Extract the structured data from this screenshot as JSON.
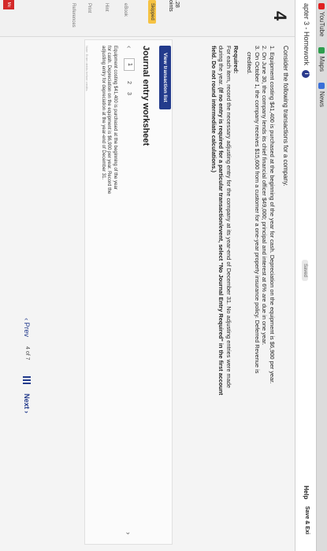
{
  "bookmarks": [
    {
      "label": "YouTube",
      "color": "#e02020"
    },
    {
      "label": "Maps",
      "color": "#2e9e4e"
    },
    {
      "label": "News",
      "color": "#3a6fd8"
    }
  ],
  "header": {
    "chapter": "apter 3 - Homework",
    "status": "Saved",
    "help": "Help",
    "save_exit": "Save & Exi"
  },
  "rail": {
    "question_number": "4",
    "points": ".28\noints",
    "skipped": "Skipped",
    "links": [
      "eBook",
      "Hint",
      "Print",
      "References"
    ]
  },
  "question": {
    "intro": "Consider the following transactions for a company.",
    "items": [
      "1. Equipment costing $41,400 is purchased at the beginning of the year for cash. Depreciation on the equipment is $6,900 per year.",
      "2. On June 30, the company lends its chief financial officer $49,000; principal and interest at 6% are due in one year.",
      "3. On October 1, the company receives $15,600 from a customer for a one-year property insurance policy. Deferred Revenue is",
      "    credited."
    ],
    "required_title": "Required:",
    "required_line1": "For each item, record the necessary adjusting entry for the company at its year-end of December 31. No adjusting entries were made",
    "required_line2_plain": "during the year. ",
    "required_line2_bold": "(If no entry is required for a particular transaction/event, select \"No Journal Entry Required\" in the first account",
    "required_line3_bold": "field. Do not round intermediate calculations.)"
  },
  "worksheet": {
    "view_button": "View transaction list",
    "title": "Journal entry worksheet",
    "pages": [
      "1",
      "2",
      "3"
    ],
    "description": "Equipment costing $41,400 is purchased at the beginning of the year for cash. Depreciation on the equipment is $6,900 per year. Record the adjusting entry for depreciation at the year-end of December 31.",
    "note": "Note: Enter debits before credits."
  },
  "footer": {
    "prev": "Prev",
    "page_of": "4  of  7",
    "next": "Next"
  },
  "brand": "Mc"
}
